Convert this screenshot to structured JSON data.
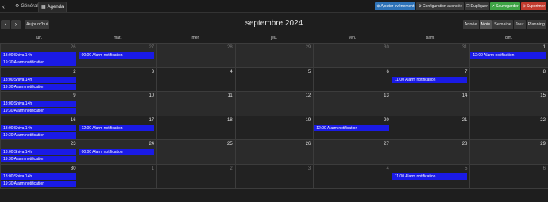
{
  "topbar": {
    "back_icon": "‹",
    "tabs": [
      {
        "label": "Général",
        "icon": "⚙"
      },
      {
        "label": "Agenda",
        "icon": "▦"
      }
    ],
    "buttons": {
      "add": "Ajouter événement",
      "config": "Configuration avancée",
      "duplicate": "Dupliquer",
      "save": "Sauvegarder",
      "delete": "Supprimer"
    },
    "colors": {
      "add": "#2e73b8",
      "save": "#3ea445",
      "delete": "#c23b2e"
    }
  },
  "calendar": {
    "prev": "‹",
    "next": "›",
    "today": "Aujourd'hui",
    "title": "septembre 2024",
    "views": [
      "Année",
      "Mois",
      "Semaine",
      "Jour",
      "Planning"
    ],
    "active_view": "Mois",
    "days_of_week": [
      "lun.",
      "mar.",
      "mer.",
      "jeu.",
      "ven.",
      "sam.",
      "dim."
    ],
    "weeks": [
      [
        {
          "d": "26",
          "o": true
        },
        {
          "d": "27",
          "o": true
        },
        {
          "d": "28",
          "o": true
        },
        {
          "d": "29",
          "o": true
        },
        {
          "d": "30",
          "o": true
        },
        {
          "d": "31",
          "o": true
        },
        {
          "d": "1",
          "o": false
        }
      ],
      [
        {
          "d": "2",
          "o": false
        },
        {
          "d": "3",
          "o": false
        },
        {
          "d": "4",
          "o": false
        },
        {
          "d": "5",
          "o": false
        },
        {
          "d": "6",
          "o": false
        },
        {
          "d": "7",
          "o": false
        },
        {
          "d": "8",
          "o": false
        }
      ],
      [
        {
          "d": "9",
          "o": false
        },
        {
          "d": "10",
          "o": false
        },
        {
          "d": "11",
          "o": false
        },
        {
          "d": "12",
          "o": false
        },
        {
          "d": "13",
          "o": false
        },
        {
          "d": "14",
          "o": false
        },
        {
          "d": "15",
          "o": false
        }
      ],
      [
        {
          "d": "16",
          "o": false
        },
        {
          "d": "17",
          "o": false
        },
        {
          "d": "18",
          "o": false
        },
        {
          "d": "19",
          "o": false
        },
        {
          "d": "20",
          "o": false
        },
        {
          "d": "21",
          "o": false
        },
        {
          "d": "22",
          "o": false
        }
      ],
      [
        {
          "d": "23",
          "o": false
        },
        {
          "d": "24",
          "o": false
        },
        {
          "d": "25",
          "o": false
        },
        {
          "d": "26",
          "o": false
        },
        {
          "d": "27",
          "o": false
        },
        {
          "d": "28",
          "o": false
        },
        {
          "d": "29",
          "o": false
        }
      ],
      [
        {
          "d": "30",
          "o": false
        },
        {
          "d": "1",
          "o": true
        },
        {
          "d": "2",
          "o": true
        },
        {
          "d": "3",
          "o": true
        },
        {
          "d": "4",
          "o": true
        },
        {
          "d": "5",
          "o": true
        },
        {
          "d": "6",
          "o": true
        }
      ]
    ],
    "events": [
      {
        "week": 0,
        "day": 0,
        "slot": 0,
        "text": "13:00 Shiva 14h"
      },
      {
        "week": 0,
        "day": 0,
        "slot": 1,
        "text": "19:30 Alarm notification"
      },
      {
        "week": 0,
        "day": 1,
        "slot": 0,
        "text": "00:00 Alarm notification"
      },
      {
        "week": 0,
        "day": 6,
        "slot": 0,
        "text": "12:00 Alarm notification"
      },
      {
        "week": 1,
        "day": 0,
        "slot": 0,
        "text": "13:00 Shiva 14h"
      },
      {
        "week": 1,
        "day": 0,
        "slot": 1,
        "text": "19:30 Alarm notification"
      },
      {
        "week": 1,
        "day": 5,
        "slot": 0,
        "text": "11:00 Alarm notification"
      },
      {
        "week": 2,
        "day": 0,
        "slot": 0,
        "text": "13:00 Shiva 14h"
      },
      {
        "week": 2,
        "day": 0,
        "slot": 1,
        "text": "19:30 Alarm notification"
      },
      {
        "week": 3,
        "day": 0,
        "slot": 0,
        "text": "13:00 Shiva 14h"
      },
      {
        "week": 3,
        "day": 0,
        "slot": 1,
        "text": "19:30 Alarm notification"
      },
      {
        "week": 3,
        "day": 1,
        "slot": 0,
        "text": "12:00 Alarm notification"
      },
      {
        "week": 3,
        "day": 4,
        "slot": 0,
        "text": "12:00 Alarm notification"
      },
      {
        "week": 4,
        "day": 0,
        "slot": 0,
        "text": "13:00 Shiva 14h"
      },
      {
        "week": 4,
        "day": 0,
        "slot": 1,
        "text": "19:30 Alarm notification"
      },
      {
        "week": 4,
        "day": 1,
        "slot": 0,
        "text": "00:00 Alarm notification"
      },
      {
        "week": 5,
        "day": 0,
        "slot": 0,
        "text": "13:00 Shiva 14h"
      },
      {
        "week": 5,
        "day": 0,
        "slot": 1,
        "text": "19:30 Alarm notification"
      },
      {
        "week": 5,
        "day": 5,
        "slot": 0,
        "text": "11:00 Alarm notification"
      }
    ],
    "colors": {
      "event": "#1a1ae6",
      "cell_a": "#2b2b2b",
      "cell_b": "#222222"
    }
  }
}
